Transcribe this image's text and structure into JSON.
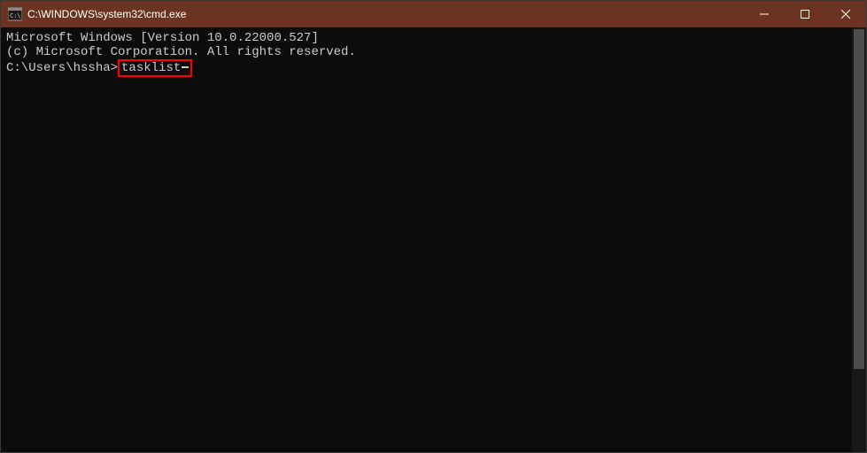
{
  "titlebar": {
    "title": "C:\\WINDOWS\\system32\\cmd.exe"
  },
  "terminal": {
    "line1": "Microsoft Windows [Version 10.0.22000.527]",
    "line2": "(c) Microsoft Corporation. All rights reserved.",
    "blank": "",
    "prompt": "C:\\Users\\hssha>",
    "command": "tasklist"
  }
}
